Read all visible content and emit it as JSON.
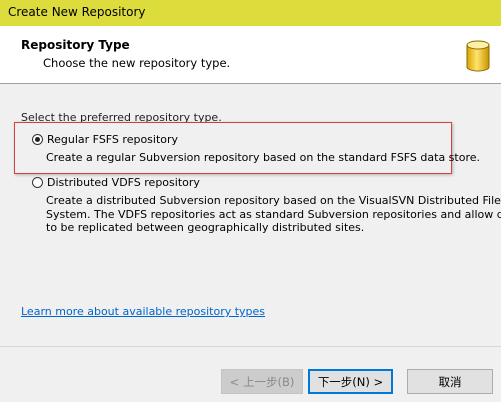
{
  "window": {
    "title": "Create New Repository",
    "titlebar_color": "#dcdc3c"
  },
  "header": {
    "title": "Repository Type",
    "subtitle": "Choose the new repository type.",
    "icon": "database-icon"
  },
  "content": {
    "prompt": "Select the preferred repository type.",
    "options": [
      {
        "label": "Regular FSFS repository",
        "selected": true,
        "description": [
          "Create a regular Subversion repository based on the standard FSFS data store."
        ]
      },
      {
        "label": "Distributed VDFS repository",
        "selected": false,
        "description": [
          "Create a distributed Subversion repository based on the VisualSVN Distributed File",
          "System. The VDFS repositories act as standard Subversion repositories and allow data",
          "to be replicated between geographically distributed sites."
        ]
      }
    ],
    "highlight_color": "#d44040",
    "learn_more_link": "Learn more about available repository types"
  },
  "buttons": {
    "back": "< 上一步(B)",
    "next": "下一步(N) >",
    "cancel": "取消"
  },
  "colors": {
    "link": "#0066cc",
    "focus_border": "#0078d7"
  }
}
